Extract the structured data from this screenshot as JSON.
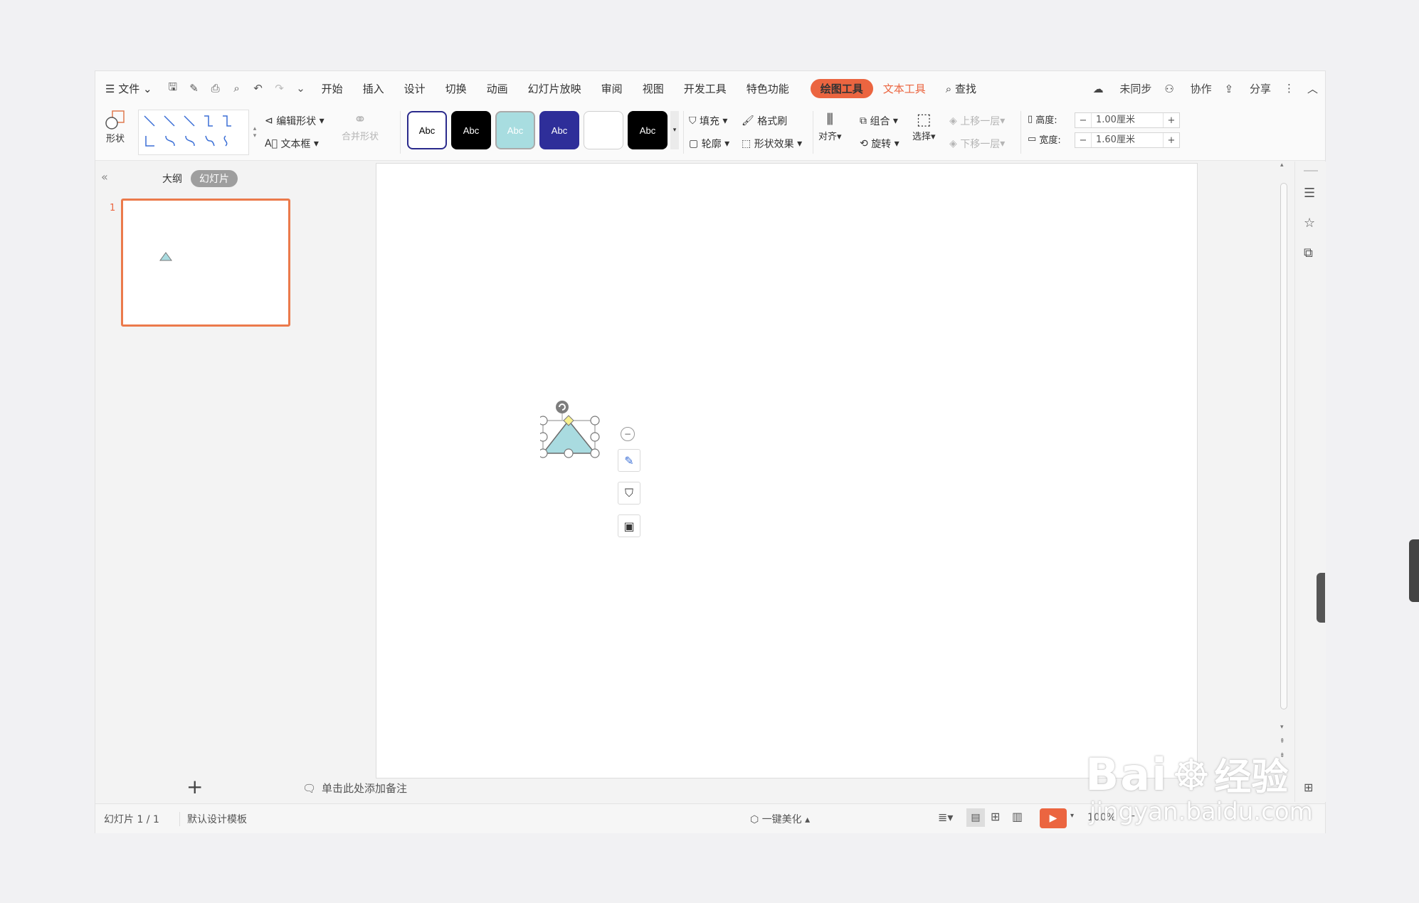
{
  "menu": {
    "file": "文件",
    "tabs": [
      "开始",
      "插入",
      "设计",
      "切换",
      "动画",
      "幻灯片放映",
      "审阅",
      "视图",
      "开发工具",
      "特色功能"
    ],
    "drawing_tools": "绘图工具",
    "text_tools": "文本工具",
    "search": "查找",
    "unsynced": "未同步",
    "collab": "协作",
    "share": "分享"
  },
  "ribbon": {
    "shape": "形状",
    "edit_shape": "编辑形状",
    "textbox": "文本框",
    "merge_shape": "合并形状",
    "swatch_label": "Abc",
    "swatches": [
      {
        "bg": "#ffffff",
        "fg": "#000000",
        "border": "#2a2a8c"
      },
      {
        "bg": "#000000",
        "fg": "#ffffff",
        "border": "#000000"
      },
      {
        "bg": "#a8dde0",
        "fg": "#ffffff",
        "border": "#8cc"
      },
      {
        "bg": "#2e2e99",
        "fg": "#ffffff",
        "border": "#2e2e99"
      },
      {
        "bg": "#ffffff",
        "fg": "#ffffff",
        "border": "#cfcfcf"
      },
      {
        "bg": "#000000",
        "fg": "#ffffff",
        "border": "#000000"
      }
    ],
    "fill": "填充",
    "format_painter": "格式刷",
    "outline": "轮廓",
    "shape_effects": "形状效果",
    "align": "对齐",
    "group": "组合",
    "rotate": "旋转",
    "select": "选择",
    "bring_forward": "上移一层",
    "send_backward": "下移一层",
    "height_label": "高度:",
    "height_value": "1.00厘米",
    "width_label": "宽度:",
    "width_value": "1.60厘米"
  },
  "panel": {
    "outline_tab": "大纲",
    "slides_tab": "幻灯片",
    "slide_number": "1",
    "add": "+"
  },
  "notes_placeholder": "单击此处添加备注",
  "status": {
    "slide_count": "幻灯片 1 / 1",
    "template": "默认设计模板",
    "beautify": "一键美化",
    "zoom": "100%"
  },
  "watermark": {
    "brand": "Bai",
    "brand_cn": "经验",
    "url": "jingyan.baidu.com"
  },
  "colors": {
    "accent": "#eb6540",
    "shape_fill": "#a9dbe0",
    "thumb_border": "#eb7a4b"
  }
}
